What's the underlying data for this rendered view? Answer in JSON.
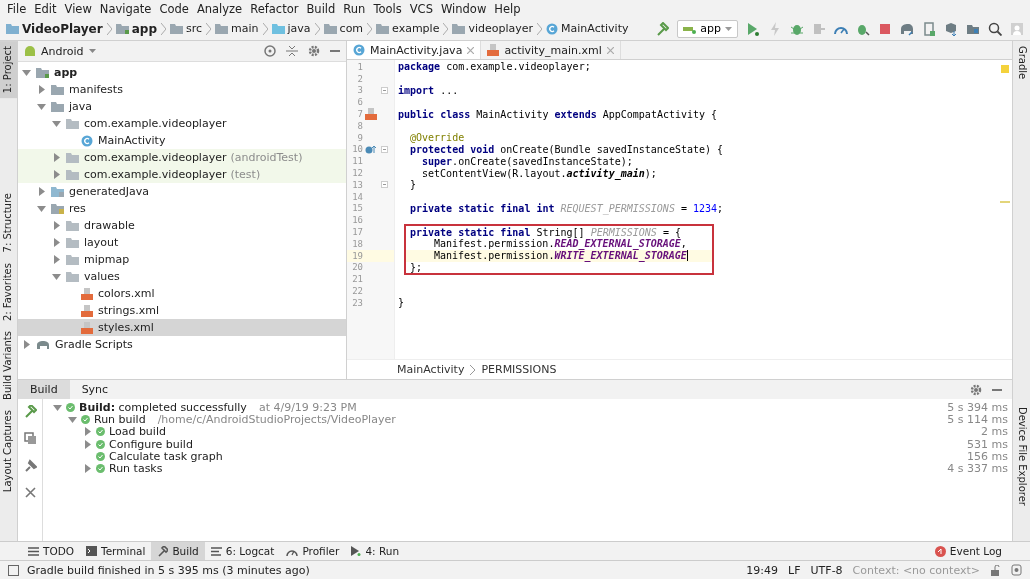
{
  "menu_bar": [
    "File",
    "Edit",
    "View",
    "Navigate",
    "Code",
    "Analyze",
    "Refactor",
    "Build",
    "Run",
    "Tools",
    "VCS",
    "Window",
    "Help"
  ],
  "breadcrumb": [
    {
      "label": "VideoPlayer",
      "kind": "project"
    },
    {
      "label": "app",
      "kind": "module"
    },
    {
      "label": "src",
      "kind": "folder"
    },
    {
      "label": "main",
      "kind": "folder"
    },
    {
      "label": "java",
      "kind": "source"
    },
    {
      "label": "com",
      "kind": "folder"
    },
    {
      "label": "example",
      "kind": "folder"
    },
    {
      "label": "videoplayer",
      "kind": "folder"
    },
    {
      "label": "MainActivity",
      "kind": "class"
    }
  ],
  "run_config": "app",
  "left_stripe": [
    {
      "label": "1: Project",
      "selected": true
    },
    {
      "label": "7: Structure",
      "selected": false
    },
    {
      "label": "2: Favorites",
      "selected": false
    },
    {
      "label": "Build Variants",
      "selected": false
    },
    {
      "label": "Layout Captures",
      "selected": false
    }
  ],
  "right_stripe": [
    "Gradle",
    "Device File Explorer"
  ],
  "project_view": {
    "mode": "Android",
    "tree": [
      {
        "label": "app",
        "kind": "module",
        "expanded": true,
        "selected": false,
        "children": [
          {
            "label": "manifests",
            "kind": "folder",
            "expanded": false,
            "selected": false
          },
          {
            "label": "java",
            "kind": "folder",
            "expanded": true,
            "selected": false,
            "children": [
              {
                "label": "com.example.videoplayer",
                "kind": "package",
                "expanded": true,
                "selected": false,
                "children": [
                  {
                    "label": "MainActivity",
                    "kind": "class",
                    "selected": false
                  }
                ]
              },
              {
                "label": "com.example.videoplayer",
                "suffix": "(androidTest)",
                "kind": "package",
                "expanded": false,
                "selected": false,
                "tinted": true
              },
              {
                "label": "com.example.videoplayer",
                "suffix": "(test)",
                "kind": "package",
                "expanded": false,
                "selected": false,
                "tinted": true
              }
            ]
          },
          {
            "label": "generatedJava",
            "kind": "gen-folder",
            "expanded": false,
            "selected": false
          },
          {
            "label": "res",
            "kind": "res-folder",
            "expanded": true,
            "selected": false,
            "children": [
              {
                "label": "drawable",
                "kind": "package",
                "expanded": false,
                "selected": false
              },
              {
                "label": "layout",
                "kind": "package",
                "expanded": false,
                "selected": false
              },
              {
                "label": "mipmap",
                "kind": "package",
                "expanded": false,
                "selected": false
              },
              {
                "label": "values",
                "kind": "package",
                "expanded": true,
                "selected": false,
                "children": [
                  {
                    "label": "colors.xml",
                    "kind": "xml",
                    "selected": false
                  },
                  {
                    "label": "strings.xml",
                    "kind": "xml",
                    "selected": false
                  },
                  {
                    "label": "styles.xml",
                    "kind": "xml",
                    "selected": true
                  }
                ]
              }
            ]
          }
        ]
      },
      {
        "label": "Gradle Scripts",
        "kind": "gradle",
        "expanded": false,
        "selected": false
      }
    ]
  },
  "editor_tabs": [
    {
      "label": "MainActivity.java",
      "kind": "class",
      "selected": true
    },
    {
      "label": "activity_main.xml",
      "kind": "xml",
      "selected": false
    }
  ],
  "code_lines": [
    {
      "number": "1",
      "kind": "plain",
      "segments": [
        {
          "kind": "kw",
          "text": "package"
        },
        {
          "kind": "plain",
          "text": " com.example.videoplayer;"
        }
      ]
    },
    {
      "number": "2",
      "kind": "plain"
    },
    {
      "number": "3",
      "kind": "plain",
      "fold": true,
      "segments": [
        {
          "kind": "kw",
          "text": "import"
        },
        {
          "kind": "plain",
          "text": " ..."
        }
      ]
    },
    {
      "number": "6",
      "kind": "plain"
    },
    {
      "number": "7",
      "kind": "layout-link",
      "segments": [
        {
          "kind": "kw",
          "text": "public class"
        },
        {
          "kind": "plain",
          "text": " MainActivity "
        },
        {
          "kind": "kw",
          "text": "extends"
        },
        {
          "kind": "plain",
          "text": " AppCompatActivity {"
        }
      ],
      "children": [
        {
          "number": "8",
          "kind": "plain"
        },
        {
          "number": "9",
          "kind": "plain",
          "segments": [
            {
              "kind": "anno",
              "text": "@Override"
            }
          ]
        },
        {
          "number": "10",
          "kind": "override",
          "fold": true,
          "segments": [
            {
              "kind": "kw",
              "text": "protected void"
            },
            {
              "kind": "plain",
              "text": " onCreate(Bundle savedInstanceState) {"
            }
          ],
          "children": [
            {
              "number": "11",
              "kind": "plain",
              "segments": [
                {
                  "kind": "kw",
                  "text": "super"
                },
                {
                  "kind": "plain",
                  "text": ".onCreate(savedInstanceState);"
                }
              ]
            },
            {
              "number": "12",
              "kind": "plain",
              "segments": [
                {
                  "kind": "plain",
                  "text": "setContentView(R.layout."
                },
                {
                  "kind": "static",
                  "text": "activity_main"
                },
                {
                  "kind": "plain",
                  "text": ");"
                }
              ]
            }
          ]
        },
        {
          "number": "13",
          "kind": "plain",
          "fold": true,
          "segments": [
            {
              "kind": "plain",
              "text": "}"
            }
          ]
        },
        {
          "number": "14",
          "kind": "plain"
        },
        {
          "number": "15",
          "kind": "plain",
          "segments": [
            {
              "kind": "kw",
              "text": "private static final int"
            },
            {
              "kind": "const",
              "text": " REQUEST_PERMISSIONS"
            },
            {
              "kind": "plain",
              "text": " = "
            },
            {
              "kind": "num",
              "text": "1234"
            },
            {
              "kind": "plain",
              "text": ";"
            }
          ]
        },
        {
          "number": "16",
          "kind": "plain"
        },
        {
          "number": "17",
          "kind": "plain",
          "boxed": true,
          "segments": [
            {
              "kind": "kw",
              "text": "private static final"
            },
            {
              "kind": "plain",
              "text": " String[] "
            },
            {
              "kind": "const",
              "text": "PERMISSIONS"
            },
            {
              "kind": "plain",
              "text": " = {"
            }
          ],
          "children": [
            {
              "number": "18",
              "kind": "continuation",
              "boxed": true,
              "segments": [
                {
                  "kind": "plain",
                  "text": "Manifest.permission."
                },
                {
                  "kind": "field",
                  "text": "READ_EXTERNAL_STORAGE"
                },
                {
                  "kind": "plain",
                  "text": ","
                }
              ]
            },
            {
              "number": "19",
              "kind": "continuation",
              "boxed": true,
              "current": true,
              "segments": [
                {
                  "kind": "plain",
                  "text": "Manifest.permission."
                },
                {
                  "kind": "field",
                  "text": "WRITE_EXTERNAL_STORAGE"
                }
              ]
            }
          ]
        },
        {
          "number": "20",
          "kind": "plain",
          "boxed": true,
          "segments": [
            {
              "kind": "plain",
              "text": "};"
            }
          ]
        },
        {
          "number": "21",
          "kind": "plain"
        },
        {
          "number": "22",
          "kind": "plain"
        }
      ]
    },
    {
      "number": "23",
      "kind": "plain",
      "segments": [
        {
          "kind": "plain",
          "text": "}"
        }
      ]
    }
  ],
  "editor_breadcrumb": [
    "MainActivity",
    "PERMISSIONS"
  ],
  "build_tabs": [
    {
      "label": "Build",
      "selected": true
    },
    {
      "label": "Sync",
      "selected": false
    }
  ],
  "build_tree": [
    {
      "text": "**Build:** completed successfully",
      "note": "at 4/9/19 9:23 PM",
      "duration": "5 s 394 ms",
      "expanded": true,
      "children": [
        {
          "text": "Run build",
          "note": "/home/c/AndroidStudioProjects/VideoPlayer",
          "duration": "5 s 114 ms",
          "expanded": true,
          "children": [
            {
              "text": "Load build",
              "duration": "2 ms",
              "expanded": false
            },
            {
              "text": "Configure build",
              "duration": "531 ms",
              "expanded": false
            },
            {
              "text": "Calculate task graph",
              "duration": "156 ms"
            },
            {
              "text": "Run tasks",
              "duration": "4 s 337 ms",
              "expanded": false
            }
          ]
        }
      ]
    }
  ],
  "tool_windows": [
    {
      "label": "TODO",
      "kind": "list",
      "selected": false
    },
    {
      "label": "Terminal",
      "kind": "terminal",
      "selected": false
    },
    {
      "label": "Build",
      "kind": "hammer",
      "selected": true
    },
    {
      "label": "6: Logcat",
      "kind": "logcat",
      "selected": false
    },
    {
      "label": "Profiler",
      "kind": "gauge",
      "selected": false
    },
    {
      "label": "4: Run",
      "kind": "run",
      "selected": false
    }
  ],
  "event_log": "Event Log",
  "status_bar": {
    "message": "Gradle build finished in 5 s 395 ms (3 minutes ago)",
    "position": "19:49",
    "line_separator": "LF",
    "encoding": "UTF-8",
    "context": "Context: <no context>"
  }
}
